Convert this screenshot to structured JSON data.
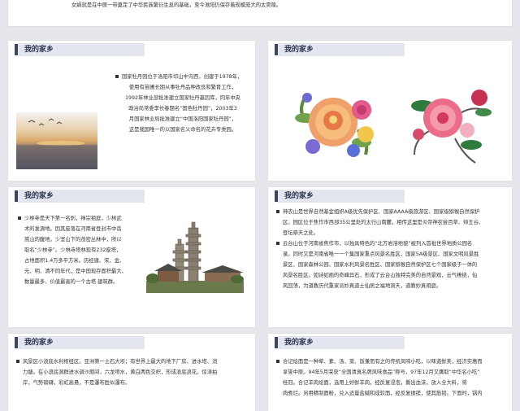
{
  "colors": {
    "accent": "#3d4660",
    "header_bg": "#e4e6ef",
    "page_bg": "#e6e7ec"
  },
  "slide0": {
    "text": "女娲就是在中原一带奠定了中华民族繁衍生息的基础，至今淮阳仍保存着规模庞大的太昊陵。"
  },
  "slide1": {
    "header": "我的家乡",
    "lines": [
      "国家牡丹园位于洛阳市邙山中沟西，创建于1978年，",
      "使用有苗圃长期从事牡丹品种改良和繁育工作，",
      "1992年林业部批准建立国家牡丹基因库，同年中央",
      "政治局常委李长春题名“国色牡丹园”，2003年3",
      "月国家林业局批准建立“中国洛阳国家牡丹园”，",
      "这是我国唯一的以国家名义命名的花卉专类园。"
    ]
  },
  "slide3": {
    "header": "我的家乡",
    "lines": [
      "少林寺是天下第一名刹，禅宗祖庭，少林武",
      "术的发源地。因其座落在河南省登封市中岳",
      "嵩山的腹地，少室山下的茂密丛林中，所以",
      "取名“少林寺”。少林寺塔林现有232座塔，",
      "占地面积1.4万多平方米。历经唐、宋、金、",
      "元、明、清不同年代，是中国现存面积最大、",
      "数量最多、价值最高的一个古塔 建筑群。"
    ]
  },
  "slide4": {
    "header": "我的家乡",
    "lines": [
      "神农山是世界自然基金组织A级优先保护区、国家AAAA级旅游区、国家级猕猴自然保护",
      "区。园区位于焦作市西部35公里处的太行山南麓，相传这里是炎帝神农尝百草、辩五谷、",
      "登坛祭天之处。",
      "云台山位于河南省焦作市，以独具特色的“北方岩溶地貌”被列入首批世界地质公园名",
      "录。同时又是河南省唯一一个集国家重点风景名胜区、国家5A级景区、国家文明风景胜",
      "景区、国家森林公园、国家水利风景名胜区、国家猕猴自然保护区七个国家级于一体的",
      "风景名胜区。如诗如画的奇峰异石，形成了云台山独特完美的自然景观，云气缭绕，仙",
      "风回荡，为道教历代重家派妙真道士仙居之福地洞天，道教妙真祖庭。"
    ]
  },
  "slide5": {
    "header": "我的家乡",
    "lines": [
      "风景区小浪底水利枢纽区。亚洲第一土石大坝；有世界上最大的地下厂房、进水塔、消",
      "力塘。在小浪底洞群进水调沙期间，六龙喷水，黄白两色交织，形成浪底浪花，惊涛拍",
      "岸，气势磅礴，彩虹高悬，不是瀑布胜似瀑布。"
    ]
  },
  "slide6": {
    "header": "我的家乡",
    "lines": [
      "合记烩面是一种荤、素、汤、菜、饭兼而有之的传统风味小吃，以味道鲜美，经济实惠而",
      "享誉中原。94年5月荣获“全国清真名牌风味食品”称号，97年12月又膺取“中华名小吃”",
      "桂冠。合记羊肉烩面，选用上好鲜羊肉，经反复浸泡，撕出血沫，放入全大料，将",
      "肉煮烂。另用精制面粉，兑入适量盐碱和成软面，经反复揉搓，使其筋韧。下面时，锅内"
    ]
  }
}
